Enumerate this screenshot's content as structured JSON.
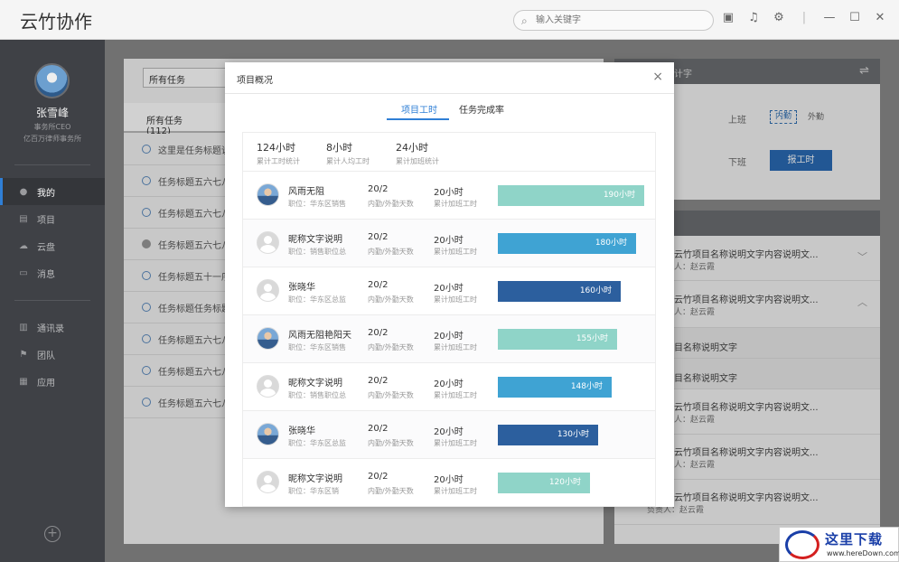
{
  "app": {
    "title": "云竹协作"
  },
  "search": {
    "placeholder": "输入关键字"
  },
  "user": {
    "name": "张雪峰",
    "role": "事务所CEO",
    "org": "亿百万律师事务所"
  },
  "nav": {
    "main": [
      {
        "label": "我的",
        "icon": "user-icon",
        "active": true
      },
      {
        "label": "项目",
        "icon": "project-icon"
      },
      {
        "label": "云盘",
        "icon": "cloud-icon"
      },
      {
        "label": "消息",
        "icon": "message-icon"
      }
    ],
    "secondary": [
      {
        "label": "通讯录",
        "icon": "contacts-icon"
      },
      {
        "label": "团队",
        "icon": "flag-icon"
      },
      {
        "label": "应用",
        "icon": "grid-icon"
      }
    ]
  },
  "tasks": {
    "filter": "所有任务",
    "tab": "所有任务 (112)",
    "items": [
      {
        "title": "这里是任务标题说",
        "done": false
      },
      {
        "title": "任务标题五六七八",
        "done": false
      },
      {
        "title": "任务标题五六七八",
        "done": false
      },
      {
        "title": "任务标题五六七八",
        "done": true
      },
      {
        "title": "任务标题五十一序",
        "done": false
      },
      {
        "title": "任务标题任务标题",
        "done": false
      },
      {
        "title": "任务标题五六七八",
        "done": false
      },
      {
        "title": "任务标题五六七八",
        "done": false
      },
      {
        "title": "任务标题五六七八",
        "done": false
      }
    ]
  },
  "attendance": {
    "header": "计字",
    "on_label": "上班",
    "off_label": "下班",
    "in_label": "内勤",
    "out_label": "外勤",
    "report_button": "报工时"
  },
  "projects": {
    "items": [
      {
        "title": "云竹项目名称说明文字内容说明文...",
        "sub": "人：赵云霞",
        "chev": "﹀"
      },
      {
        "title": "云竹项目名称说明文字内容说明文...",
        "sub": "人：赵云霞",
        "chev": "︿"
      },
      {
        "title": "目名称说明文字",
        "sub": ""
      },
      {
        "title": "目名称说明文字",
        "sub": ""
      },
      {
        "title": "云竹项目名称说明文字内容说明文...",
        "sub": "人：赵云霞"
      },
      {
        "title": "云竹项目名称说明文字内容说明文...",
        "sub": "人：赵云霞"
      },
      {
        "title": "云竹项目名称说明文字内容说明文...",
        "sub": "负责人：赵云霞"
      }
    ]
  },
  "modal": {
    "title": "项目概况",
    "close": "×",
    "tabs": [
      "项目工时",
      "任务完成率"
    ],
    "summary": [
      {
        "value": "124小时",
        "label": "累计工时统计"
      },
      {
        "value": "8小时",
        "label": "累计人均工时"
      },
      {
        "value": "24小时",
        "label": "累计加班统计"
      }
    ],
    "rows": [
      {
        "name": "风雨无阻",
        "position": "职位：华东区销售",
        "days": "20/2",
        "days_label": "内勤/外勤天数",
        "overtime": "20小时",
        "overtime_label": "累计加班工时",
        "hours": 190,
        "hours_label": "190小时",
        "color": "#8fd4c8",
        "photo": true
      },
      {
        "name": "昵称文字说明",
        "position": "职位：销售职位总",
        "days": "20/2",
        "days_label": "内勤/外勤天数",
        "overtime": "20小时",
        "overtime_label": "累计加班工时",
        "hours": 180,
        "hours_label": "180小时",
        "color": "#3fa3d3",
        "photo": false
      },
      {
        "name": "张晓华",
        "position": "职位：华东区总监",
        "days": "20/2",
        "days_label": "内勤/外勤天数",
        "overtime": "20小时",
        "overtime_label": "累计加班工时",
        "hours": 160,
        "hours_label": "160小时",
        "color": "#2c5f9e",
        "photo": false
      },
      {
        "name": "风雨无阻艳阳天",
        "position": "职位：华东区销售",
        "days": "20/2",
        "days_label": "内勤/外勤天数",
        "overtime": "20小时",
        "overtime_label": "累计加班工时",
        "hours": 155,
        "hours_label": "155小时",
        "color": "#8fd4c8",
        "photo": true
      },
      {
        "name": "昵称文字说明",
        "position": "职位：销售职位总",
        "days": "20/2",
        "days_label": "内勤/外勤天数",
        "overtime": "20小时",
        "overtime_label": "累计加班工时",
        "hours": 148,
        "hours_label": "148小时",
        "color": "#3fa3d3",
        "photo": false
      },
      {
        "name": "张晓华",
        "position": "职位：华东区总监",
        "days": "20/2",
        "days_label": "内勤/外勤天数",
        "overtime": "20小时",
        "overtime_label": "累计加班工时",
        "hours": 130,
        "hours_label": "130小时",
        "color": "#2c5f9e",
        "photo": true
      },
      {
        "name": "昵称文字说明",
        "position": "职位：华东区销",
        "days": "20/2",
        "days_label": "内勤/外勤天数",
        "overtime": "20小时",
        "overtime_label": "累计加班工时",
        "hours": 120,
        "hours_label": "120小时",
        "color": "#8fd4c8",
        "photo": false
      }
    ]
  },
  "watermark": {
    "title": "这里下载",
    "url": "www.hereDown.com"
  }
}
